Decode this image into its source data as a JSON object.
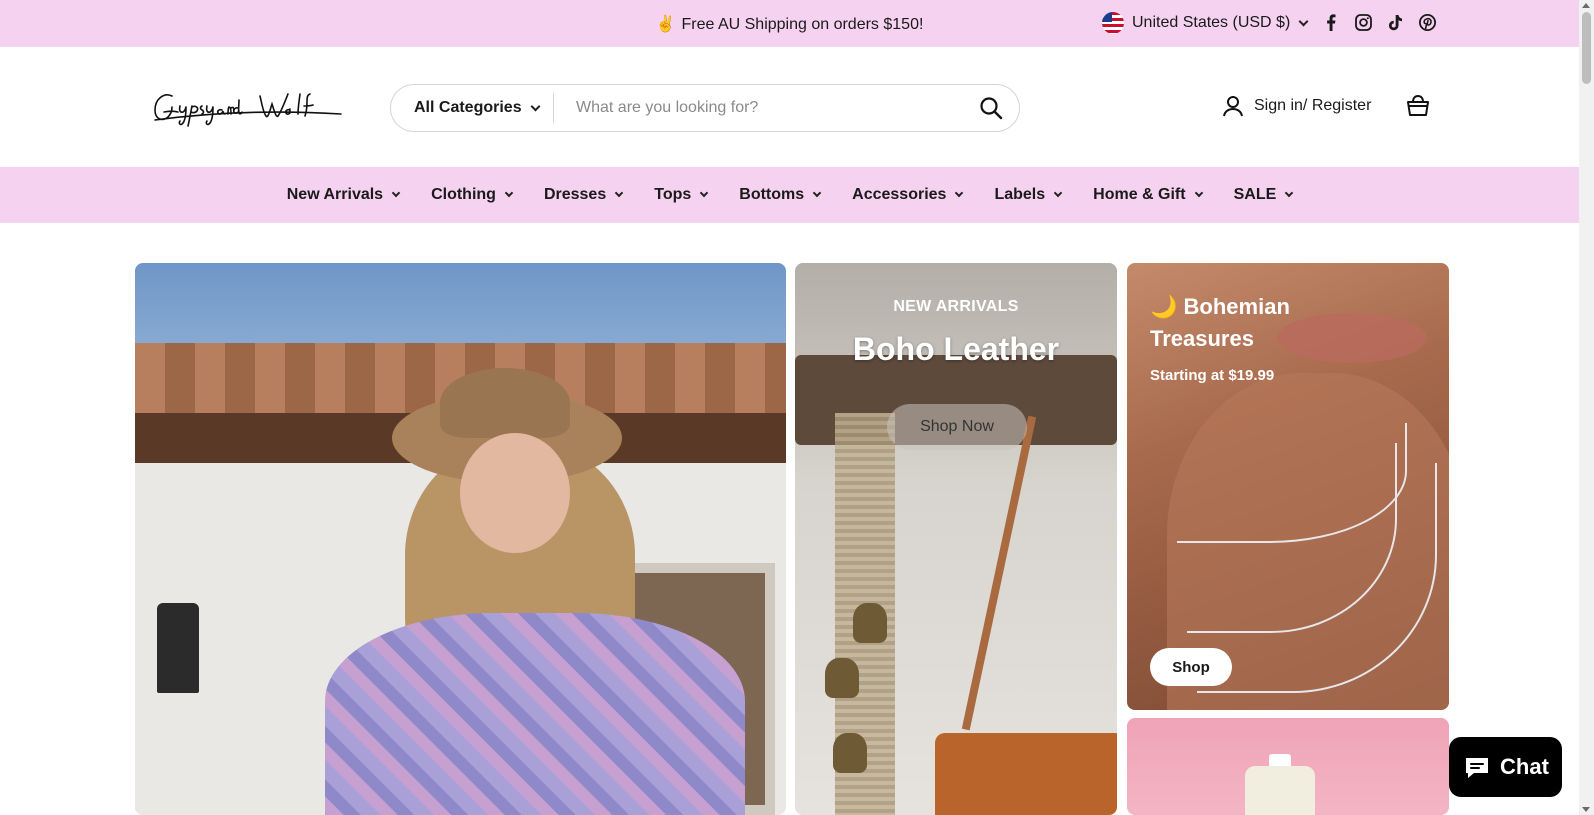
{
  "announcement": {
    "emoji": "✌️",
    "text": "Free AU Shipping on orders $150!",
    "currency": "United States (USD $)"
  },
  "header": {
    "logo_text": "Gypsy and Wolf",
    "search": {
      "category": "All Categories",
      "placeholder": "What are you looking for?"
    },
    "account_label": "Sign in/ Register"
  },
  "nav": {
    "items": [
      {
        "label": "New Arrivals"
      },
      {
        "label": "Clothing"
      },
      {
        "label": "Dresses"
      },
      {
        "label": "Tops"
      },
      {
        "label": "Bottoms"
      },
      {
        "label": "Accessories"
      },
      {
        "label": "Labels"
      },
      {
        "label": "Home & Gift"
      },
      {
        "label": "SALE"
      }
    ]
  },
  "hero": {
    "leather": {
      "eyebrow": "NEW ARRIVALS",
      "headline": "Boho Leather",
      "button": "Shop Now"
    },
    "boho": {
      "emoji": "🌙",
      "title": "Bohemian Treasures",
      "subtitle": "Starting at $19.99",
      "button": "Shop"
    }
  },
  "chat": {
    "label": "Chat"
  },
  "colors": {
    "announcement_bg": "#f6d2f1",
    "nav_bg": "#f6d2f1",
    "chat_bg": "#000000"
  },
  "icons": {
    "socials": [
      "facebook-icon",
      "instagram-icon",
      "tiktok-icon",
      "pinterest-icon"
    ]
  }
}
